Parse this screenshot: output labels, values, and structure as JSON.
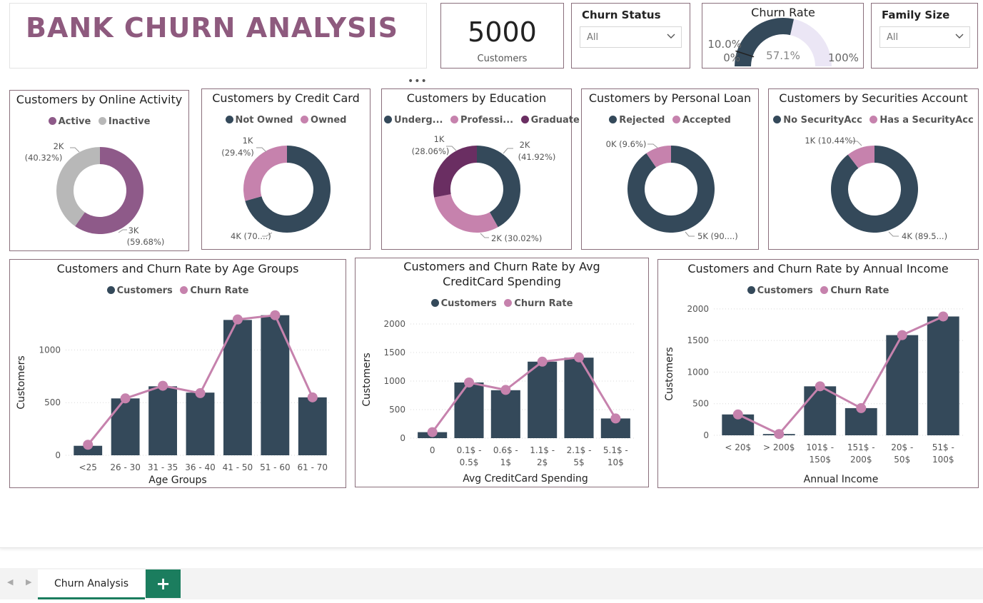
{
  "title": "BANK CHURN ANALYSIS",
  "kpi": {
    "value": "5000",
    "label": "Customers"
  },
  "slicers": {
    "churn_status": {
      "title": "Churn Status",
      "value": "All"
    },
    "family_size": {
      "title": "Family Size",
      "value": "All"
    }
  },
  "gauge": {
    "title": "Churn Rate",
    "value_label": "57.1%",
    "min_label": "0%",
    "max_label": "100%",
    "target_label": "10.0%",
    "value_fraction": 0.571,
    "target_fraction": 0.1,
    "colors": {
      "fill": "#34495a",
      "track": "#ebe6f5"
    }
  },
  "colors": {
    "dark": "#34495a",
    "pink": "#c682ad",
    "purple": "#8e5a89",
    "grey": "#b8b8b8",
    "plum": "#6a2e62"
  },
  "chart_data": [
    {
      "type": "pie",
      "title": "Customers by Online Activity",
      "legend": [
        "Active",
        "Inactive"
      ],
      "values": [
        2984,
        2016
      ],
      "colors": [
        "#8e5a89",
        "#b8b8b8"
      ],
      "data_labels": [
        "3K",
        "(59.68%)",
        "2K",
        "(40.32%)"
      ]
    },
    {
      "type": "pie",
      "title": "Customers by Credit Card",
      "legend": [
        "Not Owned",
        "Owned"
      ],
      "values": [
        3530,
        1470
      ],
      "colors": [
        "#34495a",
        "#c682ad"
      ],
      "data_labels": [
        "4K (70....)",
        "1K",
        "(29.4%)"
      ]
    },
    {
      "type": "pie",
      "title": "Customers by Education",
      "legend": [
        "Underg...",
        "Professi...",
        "Graduate"
      ],
      "values": [
        2096,
        1501,
        1403
      ],
      "colors": [
        "#34495a",
        "#c682ad",
        "#6a2e62"
      ],
      "data_labels": [
        "2K",
        "(41.92%)",
        "2K (30.02%)",
        "1K",
        "(28.06%)"
      ]
    },
    {
      "type": "pie",
      "title": "Customers by Personal Loan",
      "legend": [
        "Rejected",
        "Accepted"
      ],
      "values": [
        4520,
        480
      ],
      "colors": [
        "#34495a",
        "#c682ad"
      ],
      "data_labels": [
        "5K (90....)",
        "0K (9.6%)"
      ]
    },
    {
      "type": "pie",
      "title": "Customers by Securities Account",
      "legend": [
        "No SecurityAcc",
        "Has a SecurityAcc"
      ],
      "values": [
        4478,
        522
      ],
      "colors": [
        "#34495a",
        "#c682ad"
      ],
      "data_labels": [
        "4K (89.5...)",
        "1K (10.44%)"
      ]
    },
    {
      "type": "bar",
      "title": "Customers and Churn Rate by Age Groups",
      "legend": [
        "Customers",
        "Churn Rate"
      ],
      "xlabel": "Age Groups",
      "ylabel": "Customers",
      "ylim": [
        0,
        1450
      ],
      "yticks": [
        0,
        500,
        1000
      ],
      "categories": [
        [
          "<25"
        ],
        [
          "26 - 30"
        ],
        [
          "31 - 35"
        ],
        [
          "36 - 40"
        ],
        [
          "41 - 50"
        ],
        [
          "51 - 60"
        ],
        [
          "61 - 70"
        ]
      ],
      "series": [
        {
          "name": "Customers",
          "values": [
            90,
            540,
            655,
            595,
            1285,
            1330,
            550
          ]
        },
        {
          "name": "Churn Rate",
          "relative": [
            0.1,
            0.54,
            0.66,
            0.59,
            1.29,
            1.33,
            0.55
          ]
        }
      ]
    },
    {
      "type": "bar",
      "title": "Customers and Churn Rate by Avg CreditCard Spending",
      "legend": [
        "Customers",
        "Churn Rate"
      ],
      "xlabel": "Avg CreditCard Spending",
      "ylabel": "Customers",
      "ylim": [
        0,
        2250
      ],
      "yticks": [
        0,
        500,
        1000,
        1500,
        2000
      ],
      "categories": [
        [
          "0"
        ],
        [
          "0.1$ -",
          "0.5$"
        ],
        [
          "0.6$ -",
          "1$"
        ],
        [
          "1.1$ -",
          "2$"
        ],
        [
          "2.1$ -",
          "5$"
        ],
        [
          "5.1$ -",
          "10$"
        ]
      ],
      "series": [
        {
          "name": "Customers",
          "values": [
            105,
            975,
            840,
            1340,
            1410,
            345
          ]
        },
        {
          "name": "Churn Rate",
          "relative": [
            0.105,
            0.975,
            0.845,
            1.34,
            1.415,
            0.345
          ]
        }
      ]
    },
    {
      "type": "bar",
      "title": "Customers and Churn Rate by Annual Income",
      "legend": [
        "Customers",
        "Churn Rate"
      ],
      "xlabel": "Annual Income",
      "ylabel": "Customers",
      "ylim": [
        0,
        2100
      ],
      "yticks": [
        0,
        500,
        1000,
        1500,
        2000
      ],
      "categories": [
        [
          "< 20$"
        ],
        [
          "> 200$"
        ],
        [
          "101$ -",
          "150$"
        ],
        [
          "151$ -",
          "200$"
        ],
        [
          "20$ -",
          "50$"
        ],
        [
          "51$ -",
          "100$"
        ]
      ],
      "series": [
        {
          "name": "Customers",
          "values": [
            330,
            20,
            775,
            430,
            1585,
            1880
          ]
        },
        {
          "name": "Churn Rate",
          "relative": [
            0.33,
            0.02,
            0.775,
            0.43,
            1.585,
            1.88
          ]
        }
      ]
    }
  ],
  "tabs": [
    {
      "label": "Churn Analysis"
    }
  ],
  "add_tab_label": "+",
  "more_options": "•••"
}
